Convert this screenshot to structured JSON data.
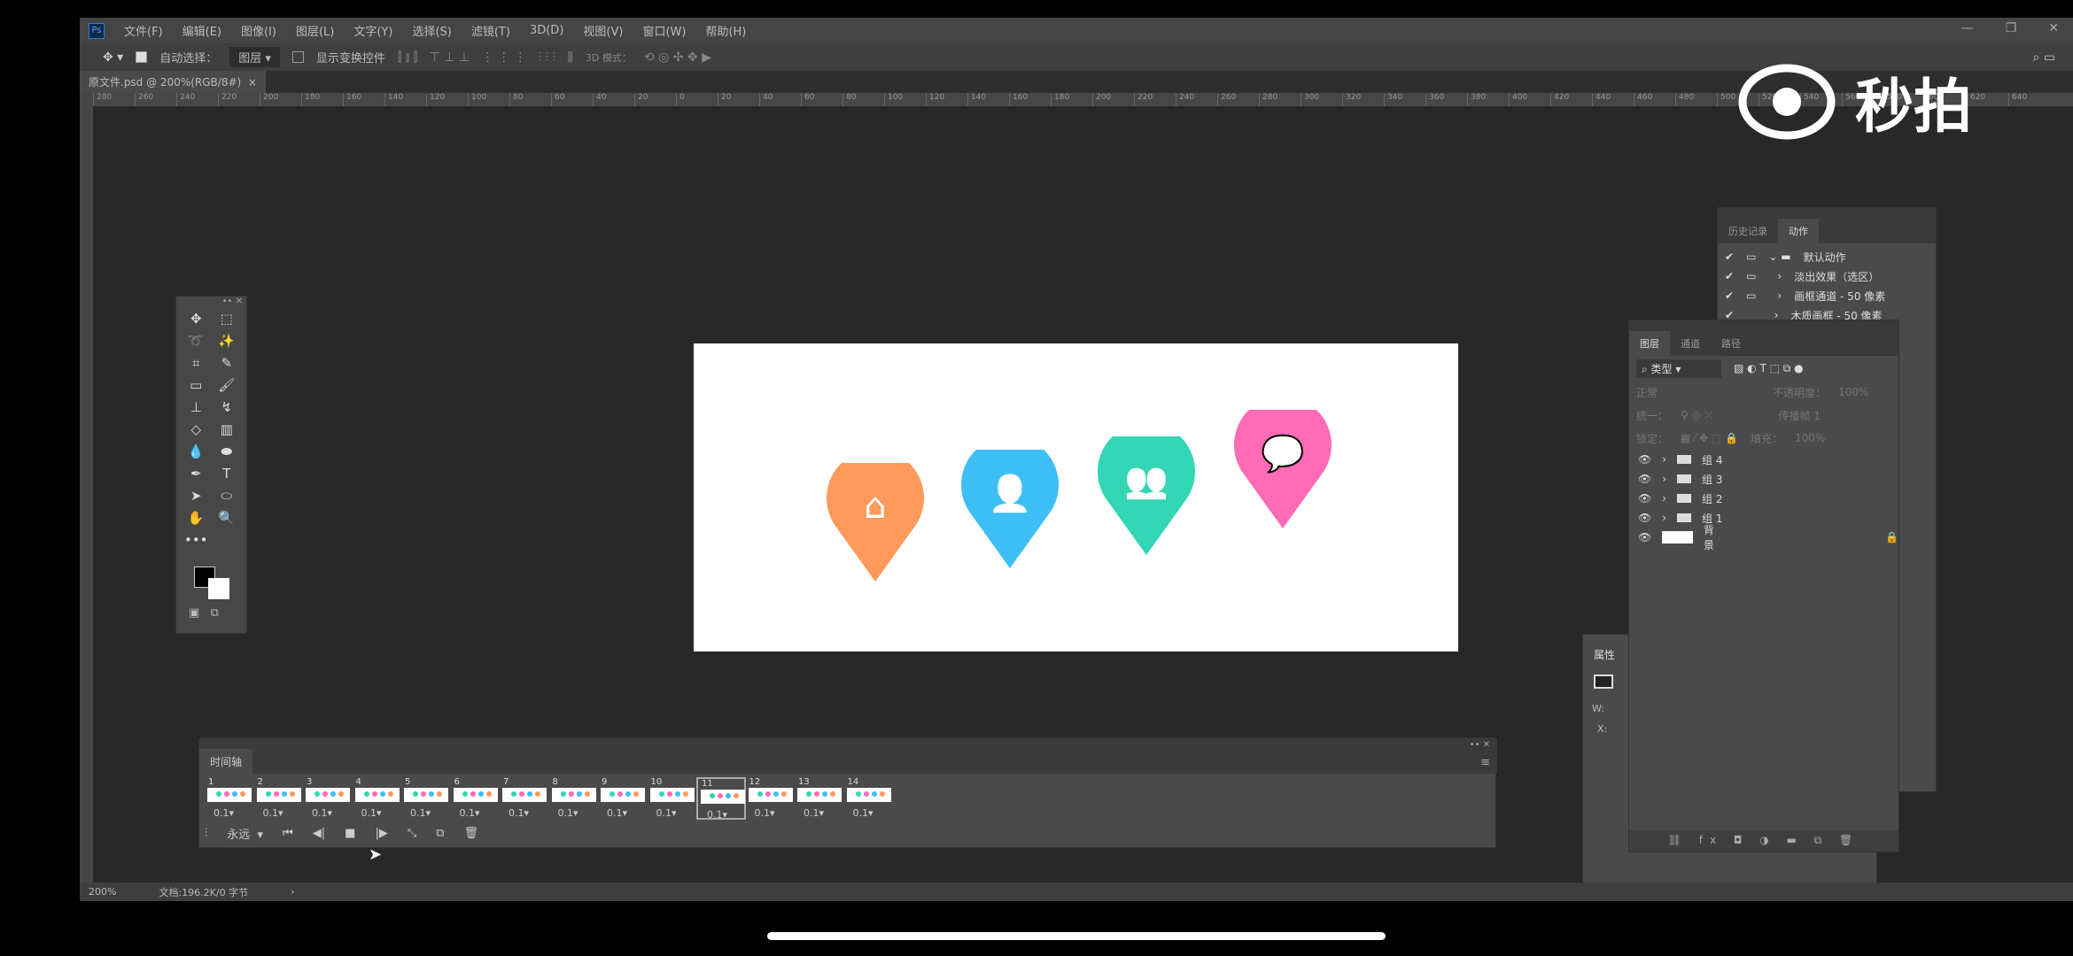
{
  "app": {
    "logo": "Ps",
    "menus": [
      "文件(F)",
      "编辑(E)",
      "图像(I)",
      "图层(L)",
      "文字(Y)",
      "选择(S)",
      "滤镜(T)",
      "3D(D)",
      "视图(V)",
      "窗口(W)",
      "帮助(H)"
    ],
    "window_controls": [
      "—",
      "❐",
      "✕"
    ]
  },
  "options": {
    "auto_select_label": "自动选择：",
    "auto_select_value": "图层",
    "show_transform_label": "显示变换控件",
    "mode_3d": "3D 模式："
  },
  "document_tab": {
    "title": "原文件.psd @ 200%(RGB/8#)",
    "close": "×"
  },
  "ruler_ticks": [
    "280",
    "260",
    "240",
    "220",
    "200",
    "180",
    "160",
    "140",
    "120",
    "100",
    "80",
    "60",
    "40",
    "20",
    "0",
    "20",
    "40",
    "60",
    "80",
    "100",
    "120",
    "140",
    "160",
    "180",
    "200",
    "220",
    "240",
    "260",
    "280",
    "300",
    "320",
    "340",
    "360",
    "380",
    "400",
    "420",
    "440",
    "460",
    "480",
    "500",
    "520",
    "540",
    "560",
    "580",
    "600",
    "620",
    "640"
  ],
  "canvas": {
    "pins": [
      {
        "icon": "home-icon",
        "color": "#FF9A5C"
      },
      {
        "icon": "user-icon",
        "color": "#3DBFF5"
      },
      {
        "icon": "group-icon",
        "color": "#33D6B4"
      },
      {
        "icon": "chat-icon",
        "color": "#FF6BB5"
      }
    ]
  },
  "timeline": {
    "title": "时间轴",
    "frames": [
      {
        "n": "1",
        "d": "0.1"
      },
      {
        "n": "2",
        "d": "0.1"
      },
      {
        "n": "3",
        "d": "0.1"
      },
      {
        "n": "4",
        "d": "0.1"
      },
      {
        "n": "5",
        "d": "0.1"
      },
      {
        "n": "6",
        "d": "0.1"
      },
      {
        "n": "7",
        "d": "0.1"
      },
      {
        "n": "8",
        "d": "0.1"
      },
      {
        "n": "9",
        "d": "0.1"
      },
      {
        "n": "10",
        "d": "0.1"
      },
      {
        "n": "11",
        "d": "0.1"
      },
      {
        "n": "12",
        "d": "0.1"
      },
      {
        "n": "13",
        "d": "0.1"
      },
      {
        "n": "14",
        "d": "0.1"
      }
    ],
    "selected_frame": "11",
    "loop": "永远"
  },
  "actions": {
    "tabs": [
      "历史记录",
      "动作"
    ],
    "items": [
      "默认动作",
      "淡出效果（选区）",
      "画框通道 - 50 像素",
      "木质画框 - 50 像素"
    ]
  },
  "layers": {
    "tabs": [
      "图层",
      "通道",
      "路径"
    ],
    "filter": "类型",
    "blend": "正常",
    "opacity_label": "不透明度：",
    "opacity": "100%",
    "unify_label": "统一：",
    "propagate": "传播帧 1",
    "lock_label": "锁定：",
    "fill_label": "填充：",
    "fill": "100%",
    "items": [
      "组 4",
      "组 3",
      "组 2",
      "组 1",
      "背景"
    ]
  },
  "properties": {
    "title": "属性",
    "w_label": "W:",
    "x_label": "X:"
  },
  "status": {
    "zoom": "200%",
    "doc": "文档:196.2K/0 字节",
    "arrow": "›"
  },
  "watermark": "秒拍"
}
